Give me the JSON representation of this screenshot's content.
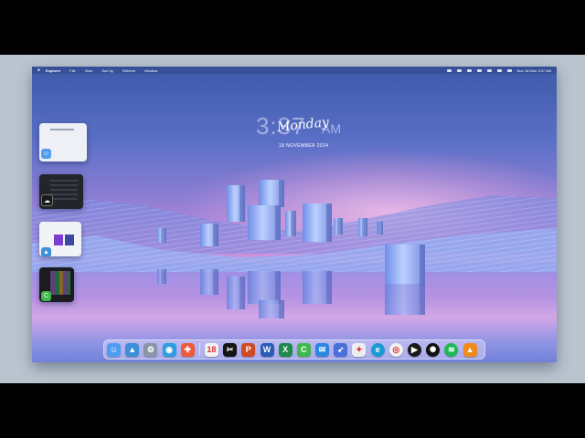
{
  "menubar": {
    "app": "Explorer",
    "items": [
      "File",
      "View",
      "Sort by",
      "Refresh",
      "Window"
    ],
    "datetime": "Nov 18 Mon 3:37 AM"
  },
  "clock": {
    "time": "3:37",
    "ampm": "AM",
    "day": "Monday",
    "date": "18 NOVEMBER 2024"
  },
  "dock": {
    "apps": [
      {
        "name": "finder",
        "glyph": "☺",
        "color": "#4f9cf0"
      },
      {
        "name": "gallery",
        "glyph": "▲",
        "color": "#3d8fd6"
      },
      {
        "name": "settings",
        "glyph": "⚙",
        "color": "#8a95a8"
      },
      {
        "name": "camera",
        "glyph": "◉",
        "color": "#2f9ee0"
      },
      {
        "name": "tools",
        "glyph": "✚",
        "color": "#ef5a3c"
      },
      {
        "name": "calendar",
        "glyph": "18",
        "color": "#f2f2f2"
      },
      {
        "name": "capcut",
        "glyph": "✂",
        "color": "#151515"
      },
      {
        "name": "powerpoint",
        "glyph": "P",
        "color": "#d04a24"
      },
      {
        "name": "word",
        "glyph": "W",
        "color": "#2b5bb6"
      },
      {
        "name": "excel",
        "glyph": "X",
        "color": "#1e8a4c"
      },
      {
        "name": "wechat",
        "glyph": "C",
        "color": "#3fb94d"
      },
      {
        "name": "mail",
        "glyph": "✉",
        "color": "#2d86e0"
      },
      {
        "name": "rocket",
        "glyph": "➶",
        "color": "#4a6fd8"
      },
      {
        "name": "maps",
        "glyph": "✦",
        "color": "#ededf2"
      },
      {
        "name": "edge",
        "glyph": "e",
        "color": "#1c9ad6"
      },
      {
        "name": "chrome",
        "glyph": "◎",
        "color": "#f2f2f2"
      },
      {
        "name": "media-player",
        "glyph": "▶",
        "color": "#1a1a1a"
      },
      {
        "name": "openai",
        "glyph": "✺",
        "color": "#111111"
      },
      {
        "name": "spotify",
        "glyph": "≋",
        "color": "#1db954"
      },
      {
        "name": "vlc",
        "glyph": "▲",
        "color": "#f08a1a"
      }
    ]
  },
  "colors": {
    "accent": "#6f8fe6",
    "sky_top": "#3d5aa8",
    "horizon": "#e0a8e4"
  }
}
